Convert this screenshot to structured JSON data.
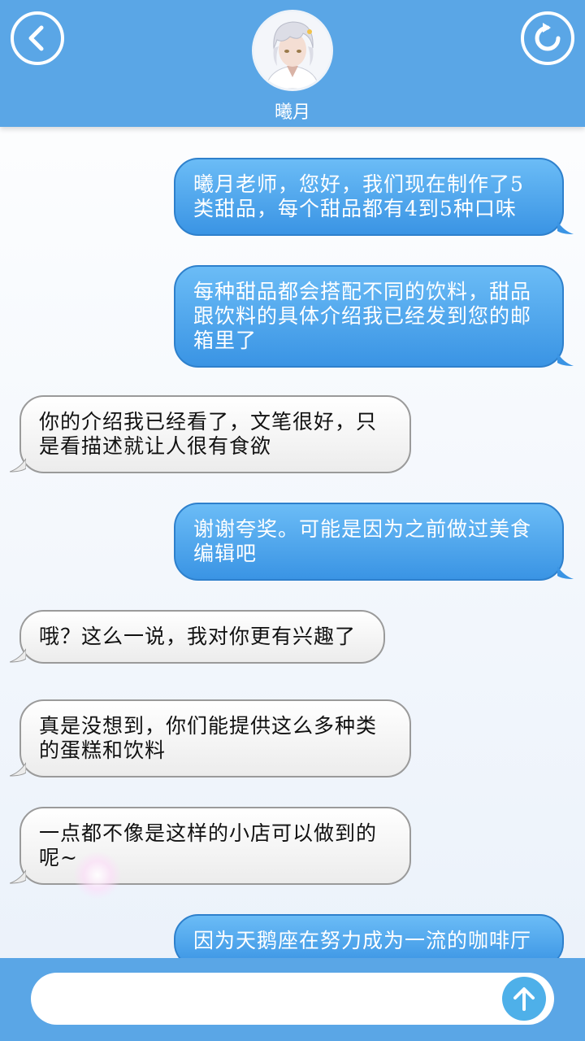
{
  "header": {
    "contact_name": "曦月"
  },
  "messages": [
    {
      "side": "out",
      "text": "曦月老师，您好，我们现在制作了5类甜品，每个甜品都有4到5种口味"
    },
    {
      "side": "out",
      "text": "每种甜品都会搭配不同的饮料，甜品跟饮料的具体介绍我已经发到您的邮箱里了"
    },
    {
      "side": "in",
      "text": "你的介绍我已经看了，文笔很好，只是看描述就让人很有食欲"
    },
    {
      "side": "out",
      "text": "谢谢夸奖。可能是因为之前做过美食编辑吧"
    },
    {
      "side": "in",
      "text": "哦？这么一说，我对你更有兴趣了"
    },
    {
      "side": "in",
      "text": "真是没想到，你们能提供这么多种类的蛋糕和饮料"
    },
    {
      "side": "in",
      "text": "一点都不像是这样的小店可以做到的呢~"
    },
    {
      "side": "out",
      "text": "因为天鹅座在努力成为一流的咖啡厅"
    }
  ],
  "input": {
    "value": "",
    "placeholder": ""
  },
  "icons": {
    "back": "chevron-left-icon",
    "refresh": "refresh-icon",
    "send": "arrow-up-icon"
  },
  "colors": {
    "header_bg": "#5aa6e6",
    "outgoing_bubble": "#3a94e4",
    "incoming_bubble": "#f2f2f2",
    "send_button": "#4eb0e9"
  }
}
